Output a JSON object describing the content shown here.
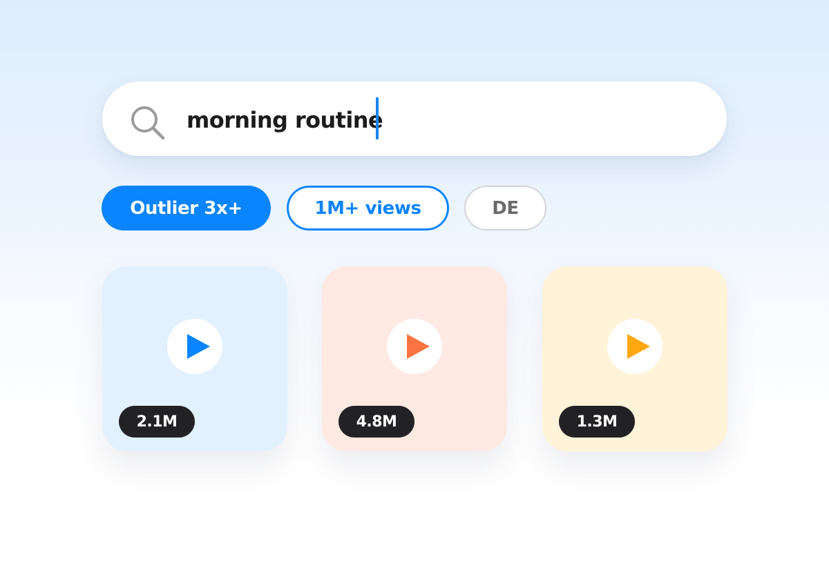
{
  "search": {
    "query": "morning routine",
    "icon": "search-icon",
    "caret_color": "#1a82f0"
  },
  "filters": [
    {
      "label": "Outlier 3x+",
      "state": "selected",
      "color": "#0a84ff"
    },
    {
      "label": "1M+ views",
      "state": "outlined",
      "color": "#0a84ff"
    },
    {
      "label": "DE",
      "state": "default",
      "color": "#6b6b6e"
    }
  ],
  "videos": [
    {
      "views": "2.1M",
      "icon": "play-icon",
      "card_color": "#e3f1fe",
      "play_color": "#0a84ff"
    },
    {
      "views": "4.8M",
      "icon": "play-icon",
      "card_color": "#fee9e3",
      "play_color": "#fb7543"
    },
    {
      "views": "1.3M",
      "icon": "play-icon",
      "card_color": "#fff3d9",
      "play_color": "#ffa70f"
    }
  ]
}
